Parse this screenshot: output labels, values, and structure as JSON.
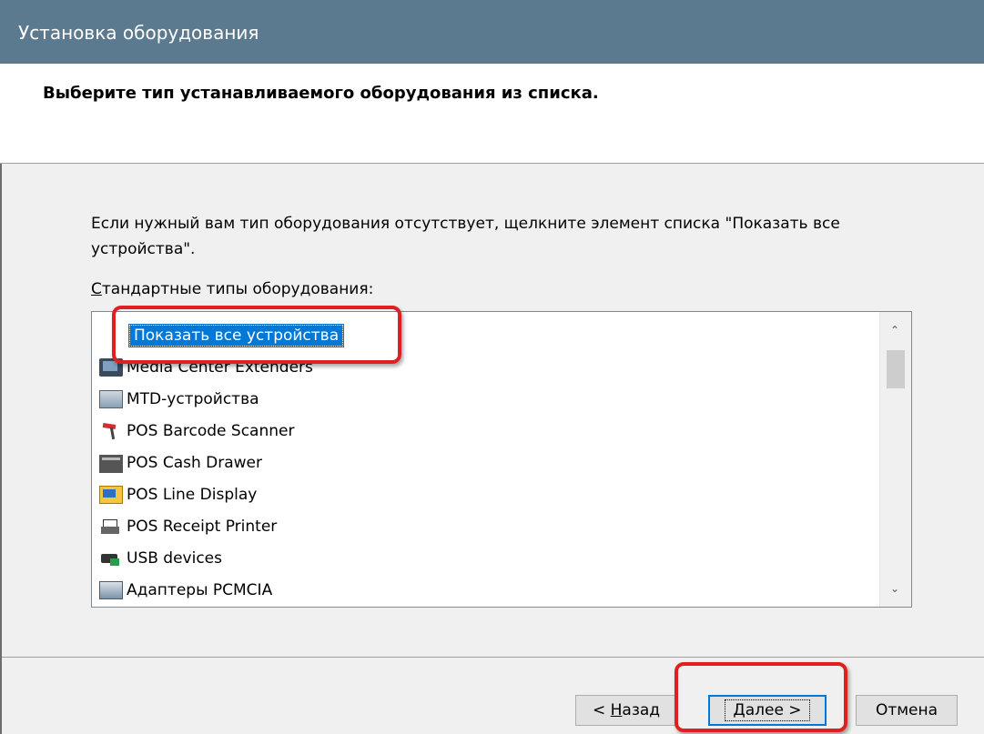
{
  "window": {
    "title": "Установка оборудования"
  },
  "header": {
    "title": "Выберите тип устанавливаемого оборудования из списка."
  },
  "content": {
    "instructions": "Если нужный вам тип оборудования отсутствует, щелкните элемент списка \"Показать все устройства\".",
    "list_label_first": "С",
    "list_label_rest": "тандартные типы оборудования:"
  },
  "list": {
    "items": [
      {
        "label": "Показать все устройства",
        "icon": "none",
        "selected": true
      },
      {
        "label": "Media Center Extenders",
        "icon": "media-center-extender-icon"
      },
      {
        "label": "MTD-устройства",
        "icon": "mtd-device-icon"
      },
      {
        "label": "POS Barcode Scanner",
        "icon": "barcode-scanner-icon"
      },
      {
        "label": "POS Cash Drawer",
        "icon": "cash-drawer-icon"
      },
      {
        "label": "POS Line Display",
        "icon": "line-display-icon"
      },
      {
        "label": "POS Receipt Printer",
        "icon": "receipt-printer-icon"
      },
      {
        "label": "USB devices",
        "icon": "usb-device-icon"
      },
      {
        "label": "Адаптеры PCMCIA",
        "icon": "pcmcia-adapter-icon"
      }
    ]
  },
  "buttons": {
    "back_pre": "< ",
    "back_mnemonic": "Н",
    "back_rest": "азад",
    "next_mnemonic": "Д",
    "next_rest": "алее >",
    "cancel": "Отмена"
  },
  "colors": {
    "titlebar": "#5b7a90",
    "selection": "#0078d7",
    "highlight": "#e02020"
  }
}
